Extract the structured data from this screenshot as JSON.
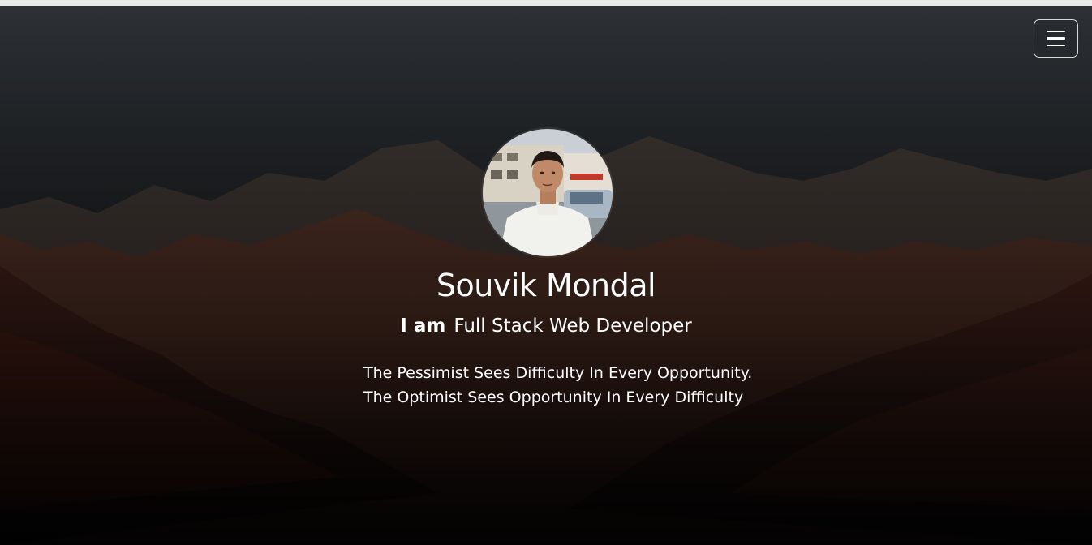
{
  "header": {
    "menu_icon": "hamburger-menu-icon"
  },
  "profile": {
    "avatar_alt": "profile photo",
    "name": "Souvik Mondal",
    "role_prefix": "I am",
    "role": "Full Stack Web Developer"
  },
  "quote": {
    "line1": "The Pessimist Sees Difficulty In Every Opportunity.",
    "line2": "The Optimist Sees Opportunity In Every Difficulty"
  },
  "colors": {
    "text": "#ffffff",
    "sky": "#2d3034",
    "mountain": "#4a2a22"
  }
}
